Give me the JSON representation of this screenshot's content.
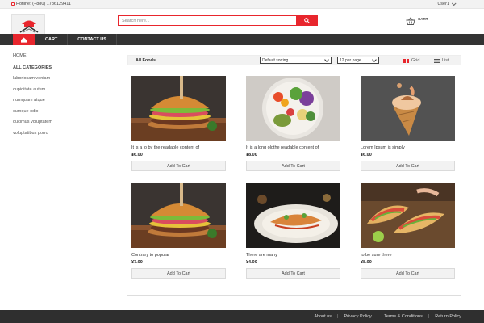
{
  "topbar": {
    "hotline": "Hotline: (+880) 1786129411",
    "user": "User1"
  },
  "header": {
    "search_placeholder": "Search here...",
    "cart_label": "CART"
  },
  "nav": {
    "items": [
      "CART",
      "CONTACT US"
    ]
  },
  "sidebar": {
    "home": "HOME",
    "categories_title": "ALL CATEGORIES",
    "categories": [
      "laboriosam veniam",
      "cupiditate autem",
      "numquam atque",
      "cumque odio",
      "ducimus voluptatem",
      "voluptatibus porro"
    ]
  },
  "toolbar": {
    "title": "All Foods",
    "sort_selected": "Default sorting",
    "perpage_selected": "12 per page",
    "grid_label": "Grid",
    "list_label": "List"
  },
  "products": [
    {
      "title": "It is a lo by the readable content of",
      "price": "¥6.00",
      "button": "Add To Cart",
      "image": "burger"
    },
    {
      "title": "It is a long oldthe readable content of",
      "price": "¥8.00",
      "button": "Add To Cart",
      "image": "salad-bowl"
    },
    {
      "title": "Lorem Ipsum is simply",
      "price": "¥6.00",
      "button": "Add To Cart",
      "image": "ice-cream-cone"
    },
    {
      "title": "Contrary to popular",
      "price": "¥7.00",
      "button": "Add To Cart",
      "image": "burger"
    },
    {
      "title": "There are many",
      "price": "¥4.00",
      "button": "Add To Cart",
      "image": "fish-dish"
    },
    {
      "title": "to be sure there",
      "price": "¥8.00",
      "button": "Add To Cart",
      "image": "tacos"
    }
  ],
  "footer": {
    "links": [
      "About us",
      "Privacy Policy",
      "Terms & Conditions",
      "Return Policy"
    ]
  },
  "colors": {
    "accent": "#e8262d",
    "nav_bg": "#333333",
    "footer_bg": "#2f2f2f"
  }
}
